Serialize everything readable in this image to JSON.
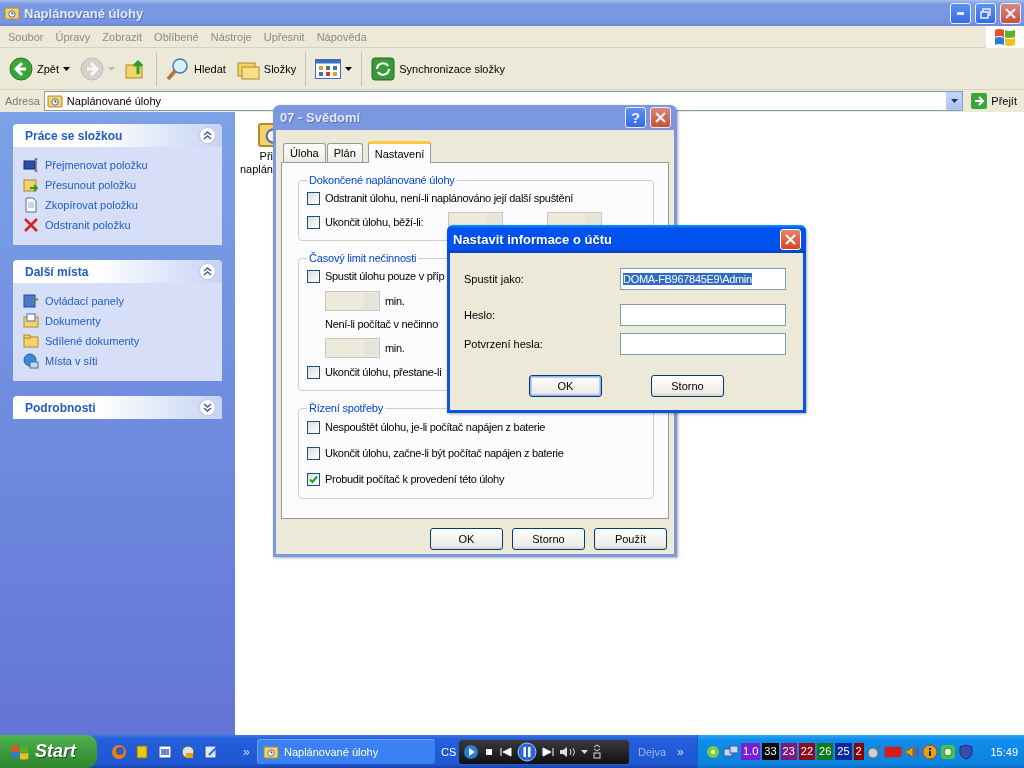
{
  "explorer": {
    "title": "Naplánované úlohy",
    "active": false,
    "menu": [
      "Soubor",
      "Úpravy",
      "Zobrazit",
      "Oblíbené",
      "Nástroje",
      "Upřesnit",
      "Nápověda"
    ],
    "toolbar": [
      {
        "kind": "back",
        "label": "Zpět",
        "disabled": false
      },
      {
        "kind": "forward",
        "disabled": true
      },
      {
        "kind": "up",
        "disabled": false
      },
      {
        "kind": "separator"
      },
      {
        "kind": "search",
        "label": "Hledat",
        "disabled": false
      },
      {
        "kind": "folders",
        "label": "Složky",
        "disabled": false
      },
      {
        "kind": "separator"
      },
      {
        "kind": "views",
        "disabled": false
      },
      {
        "kind": "separator"
      },
      {
        "kind": "sync",
        "label": "Synchronizace složky",
        "disabled": false
      }
    ],
    "address": {
      "label": "Adresa",
      "value": "Naplánované úlohy",
      "go": "Přejít"
    },
    "sidebar": [
      {
        "title": "Práce se složkou",
        "expanded": true,
        "items": [
          {
            "kind": "rename",
            "label": "Přejmenovat položku"
          },
          {
            "kind": "move",
            "label": "Přesunout položku"
          },
          {
            "kind": "copy",
            "label": "Zkopírovat položku"
          },
          {
            "kind": "delete",
            "label": "Odstranit položku"
          }
        ]
      },
      {
        "title": "Další místa",
        "expanded": true,
        "items": [
          {
            "kind": "control_panel",
            "label": "Ovládací panely"
          },
          {
            "kind": "documents",
            "label": "Dokumenty"
          },
          {
            "kind": "shared",
            "label": "Sdílené dokumenty"
          },
          {
            "kind": "network",
            "label": "Místa v síti"
          }
        ]
      },
      {
        "title": "Podrobnosti",
        "expanded": false
      }
    ],
    "content_item": {
      "lines": [
        "Při",
        "naplán"
      ]
    }
  },
  "task_dialog": {
    "title": "07 - Svědomí",
    "active": false,
    "help": "?",
    "tabs": [
      {
        "label": "Úloha",
        "selected": false
      },
      {
        "label": "Plán",
        "selected": false
      },
      {
        "label": "Nastavení",
        "selected": true
      }
    ],
    "groups": [
      {
        "title": "Dokončené naplánované úlohy",
        "rows": [
          {
            "kind": "check",
            "label": "Odstranit úlohu, není-li naplánováno její další spuštění",
            "checked": false
          },
          {
            "kind": "check_time",
            "label": "Ukončit úlohu, běží-li:",
            "checked": false,
            "disabled": true
          }
        ]
      },
      {
        "title": "Časový limit nečinnosti",
        "rows": [
          {
            "kind": "check",
            "label": "Spustit úlohu pouze v příp",
            "checked": false
          },
          {
            "kind": "spin",
            "unit": "min.",
            "disabled": true
          },
          {
            "kind": "text",
            "label": "Není-li počítač v nečinno"
          },
          {
            "kind": "spin",
            "unit": "min.",
            "disabled": true
          },
          {
            "kind": "check",
            "label": "Ukončit úlohu, přestane-li",
            "checked": false
          }
        ]
      },
      {
        "title": "Řízení spotřeby",
        "rows": [
          {
            "kind": "check",
            "label": "Nespouštět úlohu, je-li počítač napájen z baterie",
            "checked": false
          },
          {
            "kind": "check",
            "label": "Ukončit úlohu, začne-li být počítač napájen z baterie",
            "checked": false
          },
          {
            "kind": "check",
            "label": "Probudit počítač k provedení této úlohy",
            "checked": true
          }
        ]
      }
    ],
    "buttons": [
      "OK",
      "Storno",
      "Použít"
    ]
  },
  "account_dialog": {
    "title": "Nastavit informace o účtu",
    "active": true,
    "fields": [
      {
        "label": "Spustit jako:",
        "value": "DOMA-FB967845E9\\Admin",
        "selected": true
      },
      {
        "label": "Heslo:"
      },
      {
        "label": "Potvrzení hesla:"
      }
    ],
    "buttons": [
      {
        "label": "OK",
        "default": true
      },
      {
        "label": "Storno",
        "default": false
      }
    ]
  },
  "taskbar": {
    "start": "Start",
    "quick_more": "»",
    "tasks": [
      {
        "label": "Naplánované úlohy",
        "selected": false
      }
    ],
    "language": "CS",
    "media_title": "Dejva",
    "media_more": "»",
    "counters": [
      {
        "text": "1.0",
        "color": "#7a1fd0"
      },
      {
        "text": "33",
        "color": "#000000"
      },
      {
        "text": "23",
        "color": "#7a1a7a"
      },
      {
        "text": "22",
        "color": "#8a0a1a"
      },
      {
        "text": "26",
        "color": "#0a7a1a"
      },
      {
        "text": "25",
        "color": "#0a2a9a"
      },
      {
        "text": "2",
        "color": "#8a0000"
      }
    ],
    "clock": "15:49"
  }
}
